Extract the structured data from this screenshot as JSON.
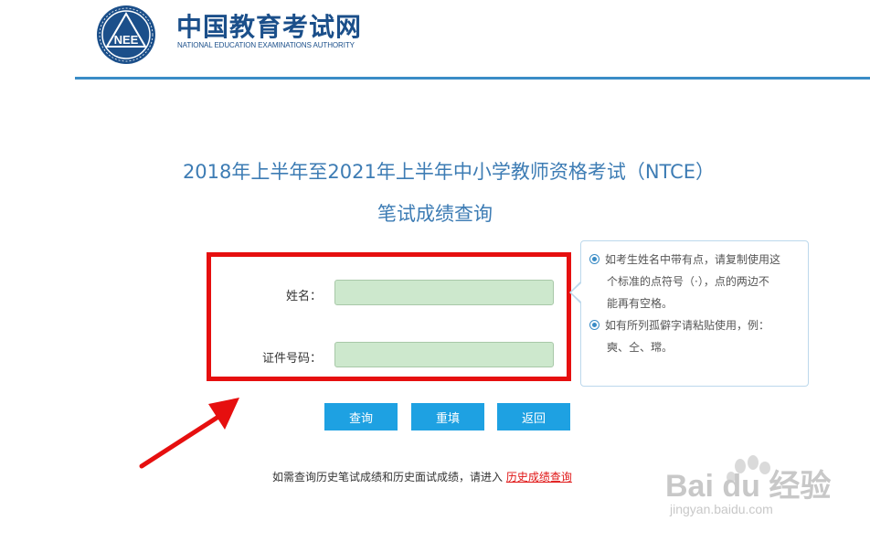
{
  "header": {
    "logo_badge_text": "NEE",
    "logo_title": "中国教育考试网",
    "logo_subtitle": "NATIONAL EDUCATION EXAMINATIONS AUTHORITY"
  },
  "main": {
    "title_line1": "2018年上半年至2021年上半年中小学教师资格考试（NTCE）",
    "title_line2": "笔试成绩查询"
  },
  "form": {
    "name_label": "姓名：",
    "name_value": "",
    "id_label": "证件号码：",
    "id_value": ""
  },
  "tips": {
    "tip1_line1": "如考生姓名中带有点，请复制使用这",
    "tip1_line2": "个标准的点符号（·），点的两边不",
    "tip1_line3": "能再有空格。",
    "tip2_line1": "如有所列孤僻字请粘贴使用，例：",
    "tip2_line2": "奭、仝、瑺。"
  },
  "buttons": {
    "query_label": "查询",
    "reset_label": "重填",
    "back_label": "返回"
  },
  "footer": {
    "history_text": "如需查询历史笔试成绩和历史面试成绩，请进入",
    "history_link": "历史成绩查询"
  },
  "watermark": {
    "main": "Bai du 经验",
    "sub": "jingyan.baidu.com"
  },
  "colors": {
    "brand_blue": "#1b4f8a",
    "title_blue": "#3d7cb4",
    "button_blue": "#1ea1e2",
    "input_green": "#cde8cd",
    "annotation_red": "#e60f0f"
  }
}
